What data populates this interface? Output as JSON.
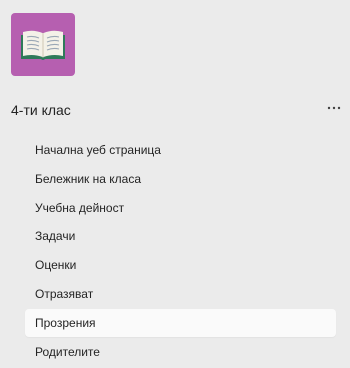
{
  "class_tile": {
    "icon": "open-book-icon",
    "tile_color": "#b65fb0"
  },
  "class_title": "4-ти клас",
  "more_button": {
    "icon": "more-horizontal-icon",
    "glyph": "···"
  },
  "nav": {
    "selected_index": 6,
    "items": [
      {
        "label": "Начална уеб страница"
      },
      {
        "label": "Бележник на класа"
      },
      {
        "label": "Учебна дейност"
      },
      {
        "label": "Задачи"
      },
      {
        "label": "Оценки"
      },
      {
        "label": "Отразяват"
      },
      {
        "label": "Прозрения"
      },
      {
        "label": "Родителите"
      }
    ]
  }
}
